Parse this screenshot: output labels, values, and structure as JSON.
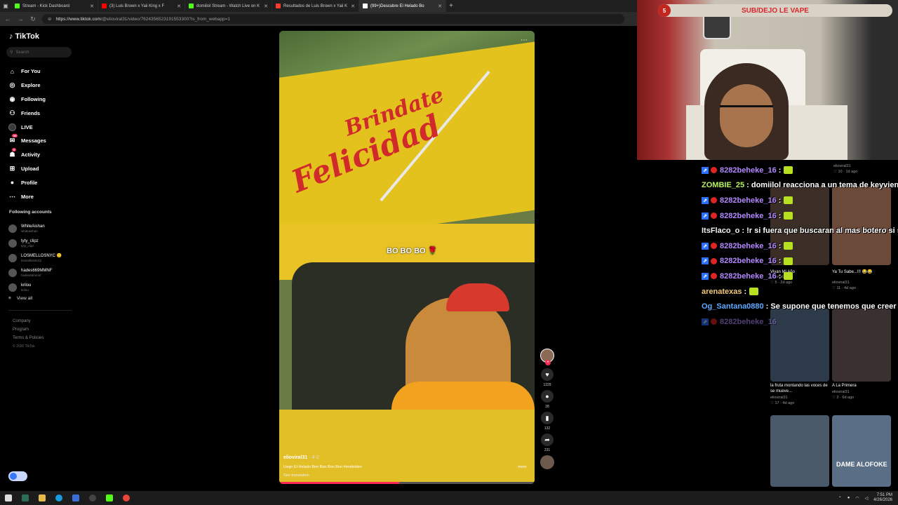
{
  "browser": {
    "tabs": [
      {
        "title": "Stream - Kick Dashboard",
        "color": "#53fc18",
        "active": false
      },
      {
        "title": "(3) Luis Brown x Yaii King x F",
        "color": "#ff0000",
        "active": false
      },
      {
        "title": "domiilol Stream - Watch Live on K",
        "color": "#53fc18",
        "active": false
      },
      {
        "title": "Resultados de Luis Brown x Yaii K",
        "color": "#ff3b2f",
        "active": false
      },
      {
        "title": "(99+)Descubre El Helado Bo",
        "color": "#ffffff",
        "active": true
      }
    ],
    "new_tab": "+",
    "url_host": "https://www.tiktok.com",
    "url_path": "/@elioviral31/video/7624356523191553300?is_from_webapp=1"
  },
  "tiktok": {
    "logo": "TikTok",
    "search_placeholder": "Search",
    "nav": [
      {
        "label": "For You",
        "icon": "home-icon"
      },
      {
        "label": "Explore",
        "icon": "compass-icon"
      },
      {
        "label": "Following",
        "icon": "following-icon"
      },
      {
        "label": "Friends",
        "icon": "friends-icon"
      },
      {
        "label": "LIVE",
        "icon": "live-icon"
      },
      {
        "label": "Messages",
        "icon": "messages-icon"
      },
      {
        "label": "Activity",
        "icon": "activity-icon"
      },
      {
        "label": "Upload",
        "icon": "upload-icon"
      },
      {
        "label": "Profile",
        "icon": "profile-icon"
      },
      {
        "label": "More",
        "icon": "more-icon"
      }
    ],
    "following_title": "Following accounts",
    "following": [
      {
        "name": "WhiteAishan",
        "handle": "whiteaishan"
      },
      {
        "name": "tyty_clipz",
        "handle": "tyty_clipz"
      },
      {
        "name": "LOSMELLOSNYC 🙂",
        "handle": "losmellosntr22"
      },
      {
        "name": "hades669MMNF",
        "handle": "hades66mmnf"
      },
      {
        "name": "krilou",
        "handle": "krilou"
      }
    ],
    "view_all": "View all",
    "footer": [
      "Company",
      "Program",
      "Terms & Policies"
    ],
    "copyright": "© 2026 TikTok"
  },
  "video": {
    "sign_line1": "Brindate",
    "sign_line2": "Felicidad",
    "overlay_caption": "BO BO BO 🌹",
    "author": "elioviral31",
    "date": "· 4-2",
    "description": "Llego El Helado Bon Bon Bon Bon #viralvideo",
    "see_translation": "See translation",
    "more": "more",
    "progress": 0.47,
    "actions": {
      "likes": "1229",
      "comments": "28",
      "saves": "132",
      "shares": "231"
    }
  },
  "stream": {
    "banner": "SUB/DEJO LE VAPE",
    "banner_num": "5"
  },
  "chat": [
    {
      "user": "8282beheke_16",
      "color": "#b389ff",
      "text": ":",
      "badges": true,
      "emote": true,
      "fade": false
    },
    {
      "user": "ZOMBIE_25",
      "color": "#b6f25b",
      "text": ": domiilol reacciona a un tema de keyvien",
      "badges": false,
      "emote": false,
      "fade": false
    },
    {
      "user": "8282beheke_16",
      "color": "#b389ff",
      "text": ":",
      "badges": true,
      "emote": true,
      "fade": false
    },
    {
      "user": "8282beheke_16",
      "color": "#b389ff",
      "text": ":",
      "badges": true,
      "emote": true,
      "fade": false
    },
    {
      "user": "ItsFlaco_o",
      "color": "#f1f1f1",
      "text": ": !r si fuera que buscaran al mas botero si s",
      "badges": false,
      "emote": false,
      "fade": false
    },
    {
      "user": "8282beheke_16",
      "color": "#b389ff",
      "text": ":",
      "badges": true,
      "emote": true,
      "fade": false
    },
    {
      "user": "8282beheke_16",
      "color": "#b389ff",
      "text": ":",
      "badges": true,
      "emote": true,
      "fade": false
    },
    {
      "user": "8282beheke_16",
      "color": "#b389ff",
      "text": ":",
      "badges": true,
      "emote": true,
      "fade": false
    },
    {
      "user": "arenatexas",
      "color": "#f0c97a",
      "text": ":",
      "badges": false,
      "emote": true,
      "fade": false
    },
    {
      "user": "Og_Santana0880",
      "color": "#5fa8ff",
      "text": ": Se supone que tenemos que creer",
      "badges": false,
      "emote": false,
      "fade": false
    },
    {
      "user": "8282beheke_16",
      "color": "#b389ff",
      "text": "",
      "badges": true,
      "emote": false,
      "fade": true
    }
  ],
  "grid": [
    {
      "caption": "Vivan Mi Año",
      "author": "elioviral31",
      "meta": "♡ 5 · 2d ago"
    },
    {
      "caption": "Ya Tu Sabe...!!! 😂😂",
      "author": "elioviral31",
      "meta": "♡ 11 · 4d ago"
    },
    {
      "caption": "la fruta montando las voces de se mueve...",
      "author": "elioviral31",
      "meta": "♡ 17 · 4d ago"
    },
    {
      "caption": "A La Primera",
      "author": "elioviral31",
      "meta": "♡ 2 · 6d ago"
    },
    {
      "caption": "",
      "author": "elioviral31",
      "meta": "♡ 10 · 1d ago"
    }
  ],
  "grid_overlay_text": "DAME ALOFOKE",
  "taskbar": {
    "time": "7:51 PM",
    "date": "4/26/2026"
  }
}
